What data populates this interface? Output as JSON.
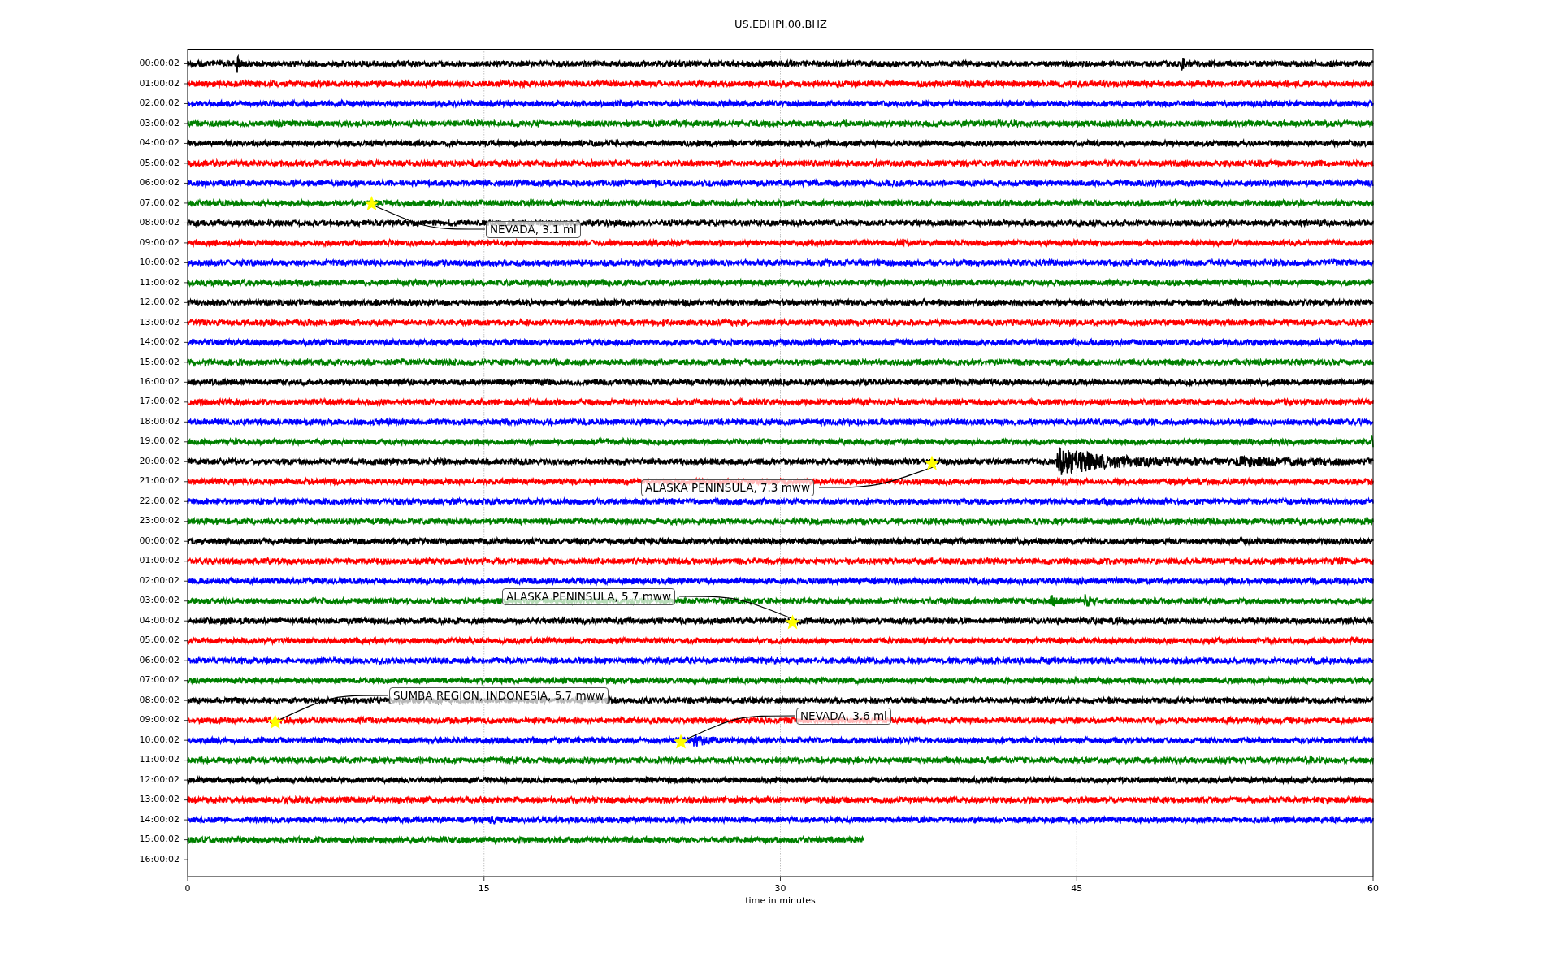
{
  "title": "US.EDHPI.00.BHZ",
  "rows": [
    {
      "label": "00:00:02",
      "color": "#000000",
      "level": 1
    },
    {
      "label": "01:00:02",
      "color": "#ff0000",
      "level": 1
    },
    {
      "label": "02:00:02",
      "color": "#0000ff",
      "level": 1
    },
    {
      "label": "03:00:02",
      "color": "#008000",
      "level": 1
    },
    {
      "label": "04:00:02",
      "color": "#000000",
      "level": 1
    },
    {
      "label": "05:00:02",
      "color": "#ff0000",
      "level": 1
    },
    {
      "label": "06:00:02",
      "color": "#0000ff",
      "level": 1
    },
    {
      "label": "07:00:02",
      "color": "#008000",
      "level": 1
    },
    {
      "label": "08:00:02",
      "color": "#000000",
      "level": 1
    },
    {
      "label": "09:00:02",
      "color": "#ff0000",
      "level": 1
    },
    {
      "label": "10:00:02",
      "color": "#0000ff",
      "level": 1
    },
    {
      "label": "11:00:02",
      "color": "#008000",
      "level": 1
    },
    {
      "label": "12:00:02",
      "color": "#000000",
      "level": 1
    },
    {
      "label": "13:00:02",
      "color": "#ff0000",
      "level": 1
    },
    {
      "label": "14:00:02",
      "color": "#0000ff",
      "level": 1
    },
    {
      "label": "15:00:02",
      "color": "#008000",
      "level": 1
    },
    {
      "label": "16:00:02",
      "color": "#000000",
      "level": 1
    },
    {
      "label": "17:00:02",
      "color": "#ff0000",
      "level": 1
    },
    {
      "label": "18:00:02",
      "color": "#0000ff",
      "level": 1
    },
    {
      "label": "19:00:02",
      "color": "#008000",
      "level": 1
    },
    {
      "label": "20:00:02",
      "color": "#000000",
      "level": 1
    },
    {
      "label": "21:00:02",
      "color": "#ff0000",
      "level": 1
    },
    {
      "label": "22:00:02",
      "color": "#0000ff",
      "level": 1
    },
    {
      "label": "23:00:02",
      "color": "#008000",
      "level": 1
    },
    {
      "label": "00:00:02",
      "color": "#000000",
      "level": 1
    },
    {
      "label": "01:00:02",
      "color": "#ff0000",
      "level": 1
    },
    {
      "label": "02:00:02",
      "color": "#0000ff",
      "level": 1
    },
    {
      "label": "03:00:02",
      "color": "#008000",
      "level": 1
    },
    {
      "label": "04:00:02",
      "color": "#000000",
      "level": 1
    },
    {
      "label": "05:00:02",
      "color": "#ff0000",
      "level": 1
    },
    {
      "label": "06:00:02",
      "color": "#0000ff",
      "level": 1
    },
    {
      "label": "07:00:02",
      "color": "#008000",
      "level": 1
    },
    {
      "label": "08:00:02",
      "color": "#000000",
      "level": 1
    },
    {
      "label": "09:00:02",
      "color": "#ff0000",
      "level": 1
    },
    {
      "label": "10:00:02",
      "color": "#0000ff",
      "level": 1
    },
    {
      "label": "11:00:02",
      "color": "#008000",
      "level": 1
    },
    {
      "label": "12:00:02",
      "color": "#000000",
      "level": 1
    },
    {
      "label": "13:00:02",
      "color": "#ff0000",
      "level": 1
    },
    {
      "label": "14:00:02",
      "color": "#0000ff",
      "level": 1
    },
    {
      "label": "15:00:02",
      "color": "#008000",
      "level": 0.57
    },
    {
      "label": "16:00:02"
    }
  ],
  "x_ticks": [
    "0",
    "15",
    "30",
    "45",
    "60"
  ],
  "x_label": "time in minutes",
  "annotations": [
    {
      "text": "NEVADA, 3.1 ml"
    },
    {
      "text": "ALASKA PENINSULA, 7.3 mww"
    },
    {
      "text": "ALASKA PENINSULA, 5.7 mww"
    },
    {
      "text": "SUMBA REGION, INDONESIA, 5.7 mww"
    },
    {
      "text": "NEVADA, 3.6 ml"
    }
  ]
}
